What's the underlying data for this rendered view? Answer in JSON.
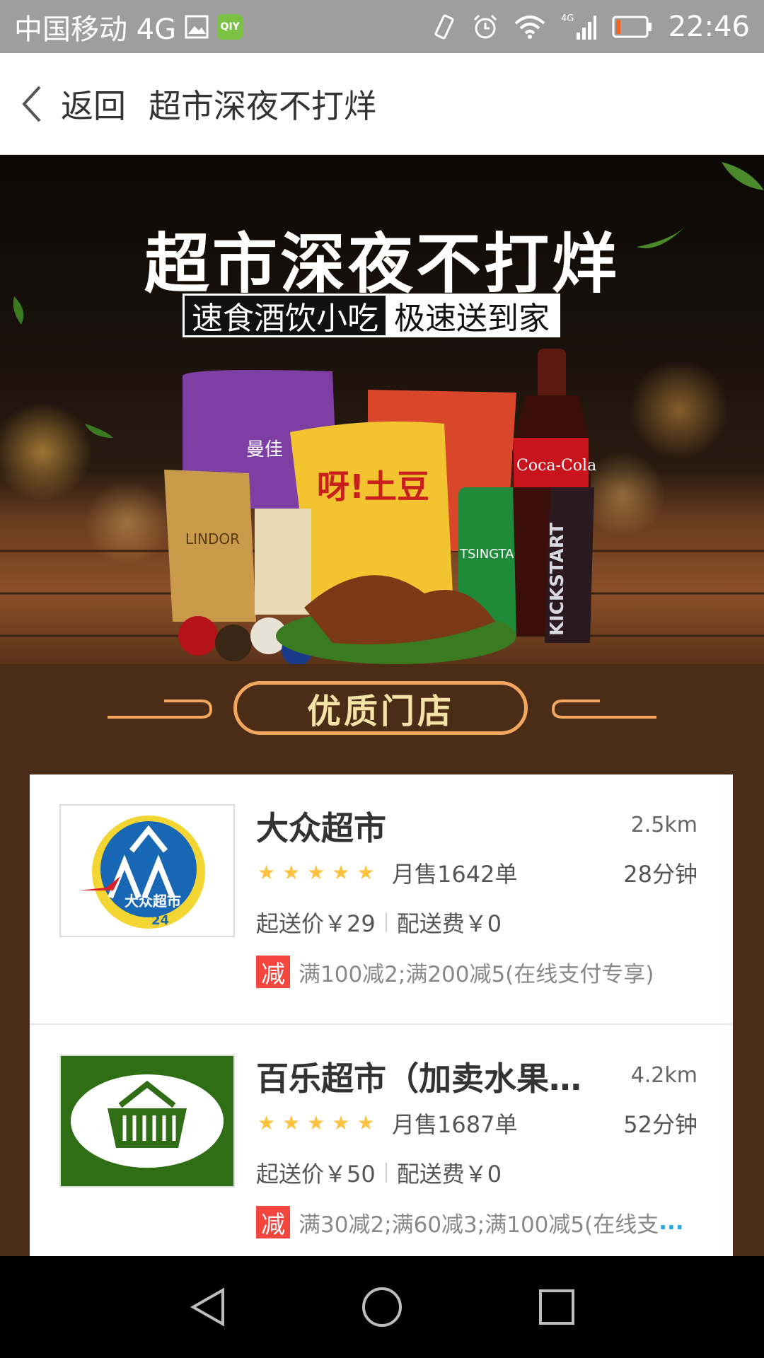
{
  "status_bar": {
    "carrier": "中国移动 4G",
    "time": "22:46",
    "icons": [
      "image-icon",
      "iqiyi-icon",
      "vibrate-icon",
      "alarm-icon",
      "wifi-icon",
      "signal-4g-icon",
      "battery-icon"
    ],
    "iqiyi_label": "QIY"
  },
  "header": {
    "back_label": "返回",
    "title": "超市深夜不打烊"
  },
  "banner": {
    "title": "超市深夜不打烊",
    "subtitle_left": "速食酒饮小吃",
    "subtitle_right": "极速送到家",
    "product_labels": [
      "曼佳",
      "LINDOR",
      "呀!土豆",
      "TSINGTAO",
      "Coca-Cola",
      "KICKSTART"
    ]
  },
  "section": {
    "title": "优质门店"
  },
  "stores": [
    {
      "name": "大众超市",
      "distance": "2.5km",
      "rating": 5,
      "sales": "月售1642单",
      "delivery_time": "28分钟",
      "min_order": "起送价￥29",
      "delivery_fee": "配送费￥0",
      "promo_badge": "减",
      "promo": "满100减2;满200减5(在线支付专享)",
      "promo_more": "",
      "logo_text": "大众超市",
      "logo_badge": "24"
    },
    {
      "name": "百乐超市（加卖水果喽...",
      "distance": "4.2km",
      "rating": 5,
      "sales": "月售1687单",
      "delivery_time": "52分钟",
      "min_order": "起送价￥50",
      "delivery_fee": "配送费￥0",
      "promo_badge": "减",
      "promo": "满30减2;满60减3;满100减5(在线支",
      "promo_more": "...",
      "logo_text": "",
      "logo_badge": ""
    }
  ],
  "nav_bar": {
    "buttons": [
      "back-triangle-icon",
      "home-circle-icon",
      "recents-square-icon"
    ]
  },
  "colors": {
    "page_background": "#4a2c17",
    "section_border": "#f2a65e",
    "section_text": "#f4e3a6",
    "star": "#ffc23e",
    "promo_badge": "#f2463f",
    "status_bar": "#9e9e9e"
  }
}
